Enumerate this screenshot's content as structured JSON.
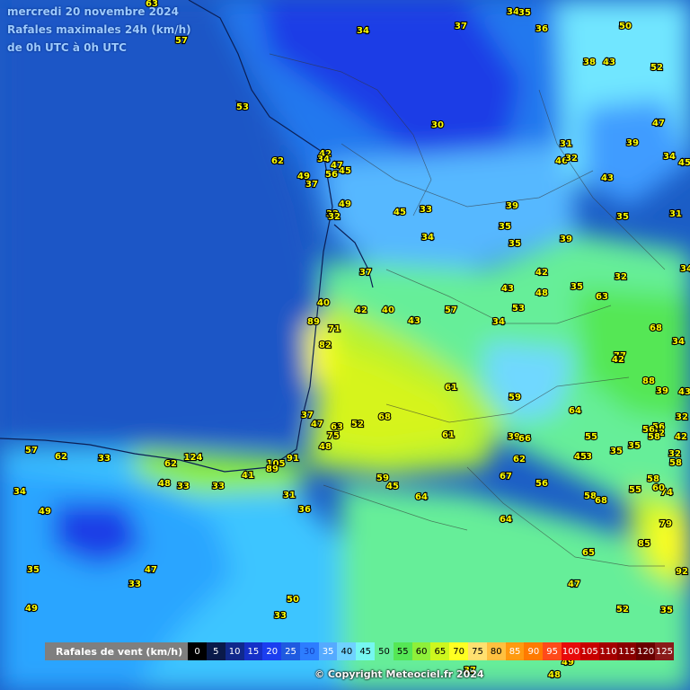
{
  "header": {
    "date": "mercredi 20 novembre 2024",
    "product": "Rafales maximales 24h (km/h)",
    "period": "de 0h UTC à 0h UTC"
  },
  "legend": {
    "label": "Rafales de vent (km/h)",
    "items": [
      {
        "value": "0",
        "color": "#000000",
        "text_color": "#ffffff"
      },
      {
        "value": "5",
        "color": "#0a1a4a",
        "text_color": "#ffffff"
      },
      {
        "value": "10",
        "color": "#10298c",
        "text_color": "#ffffff"
      },
      {
        "value": "15",
        "color": "#1530c8",
        "text_color": "#ffffff"
      },
      {
        "value": "20",
        "color": "#1b3ef0",
        "text_color": "#ffffff"
      },
      {
        "value": "25",
        "color": "#1f5ae0",
        "text_color": "#ffffff"
      },
      {
        "value": "30",
        "color": "#2d7dff",
        "text_color": "#1540c0"
      },
      {
        "value": "35",
        "color": "#55aaff",
        "text_color": "#ffffff"
      },
      {
        "value": "40",
        "color": "#6fd2ff",
        "text_color": "#000000"
      },
      {
        "value": "45",
        "color": "#76f7f0",
        "text_color": "#000000"
      },
      {
        "value": "50",
        "color": "#66ee99",
        "text_color": "#000000"
      },
      {
        "value": "55",
        "color": "#55e755",
        "text_color": "#000000"
      },
      {
        "value": "60",
        "color": "#8ef03a",
        "text_color": "#000000"
      },
      {
        "value": "65",
        "color": "#cdf71e",
        "text_color": "#000000"
      },
      {
        "value": "70",
        "color": "#ffff22",
        "text_color": "#000000"
      },
      {
        "value": "75",
        "color": "#ffe070",
        "text_color": "#000000"
      },
      {
        "value": "80",
        "color": "#ffc040",
        "text_color": "#000000"
      },
      {
        "value": "85",
        "color": "#ff9a10",
        "text_color": "#ffffff"
      },
      {
        "value": "90",
        "color": "#ff7a00",
        "text_color": "#ffffff"
      },
      {
        "value": "95",
        "color": "#ff4a1a",
        "text_color": "#ffffff"
      },
      {
        "value": "100",
        "color": "#e80a0a",
        "text_color": "#ffffff"
      },
      {
        "value": "105",
        "color": "#c80000",
        "text_color": "#ffffff"
      },
      {
        "value": "110",
        "color": "#a50000",
        "text_color": "#ffffff"
      },
      {
        "value": "115",
        "color": "#8a0000",
        "text_color": "#ffffff"
      },
      {
        "value": "120",
        "color": "#6a0000",
        "text_color": "#ffffff"
      },
      {
        "value": "125",
        "color": "#8a1a1a",
        "text_color": "#ffffff"
      }
    ]
  },
  "copyright": "© Copyright Meteociel.fr 2024",
  "station_values": [
    "63",
    "57",
    "34",
    "37",
    "34",
    "35",
    "36",
    "50",
    "38",
    "43",
    "52",
    "53",
    "30",
    "47",
    "31",
    "46",
    "32",
    "39",
    "34",
    "45",
    "62",
    "42",
    "34",
    "47",
    "45",
    "49",
    "37",
    "56",
    "43",
    "35",
    "31",
    "45",
    "33",
    "39",
    "32",
    "32",
    "49",
    "35",
    "34",
    "35",
    "39",
    "37",
    "42",
    "32",
    "48",
    "43",
    "34",
    "35",
    "63",
    "40",
    "42",
    "40",
    "43",
    "57",
    "53",
    "89",
    "71",
    "68",
    "34",
    "82",
    "34",
    "77",
    "42",
    "88",
    "39",
    "61",
    "59",
    "64",
    "43",
    "37",
    "63",
    "52",
    "68",
    "47",
    "75",
    "61",
    "56",
    "42",
    "56",
    "58",
    "57",
    "62",
    "124",
    "33",
    "48",
    "62",
    "39",
    "66",
    "55",
    "53",
    "45",
    "35",
    "35",
    "42",
    "32",
    "58",
    "34",
    "33",
    "48",
    "33",
    "41",
    "105",
    "91",
    "89",
    "67",
    "62",
    "56",
    "58",
    "74",
    "60",
    "59",
    "45",
    "31",
    "64",
    "58",
    "68",
    "55",
    "36",
    "49",
    "64",
    "79",
    "85",
    "32",
    "65",
    "35",
    "47",
    "92",
    "33",
    "47",
    "49",
    "50",
    "33",
    "52",
    "35",
    "37",
    "48",
    "49"
  ]
}
